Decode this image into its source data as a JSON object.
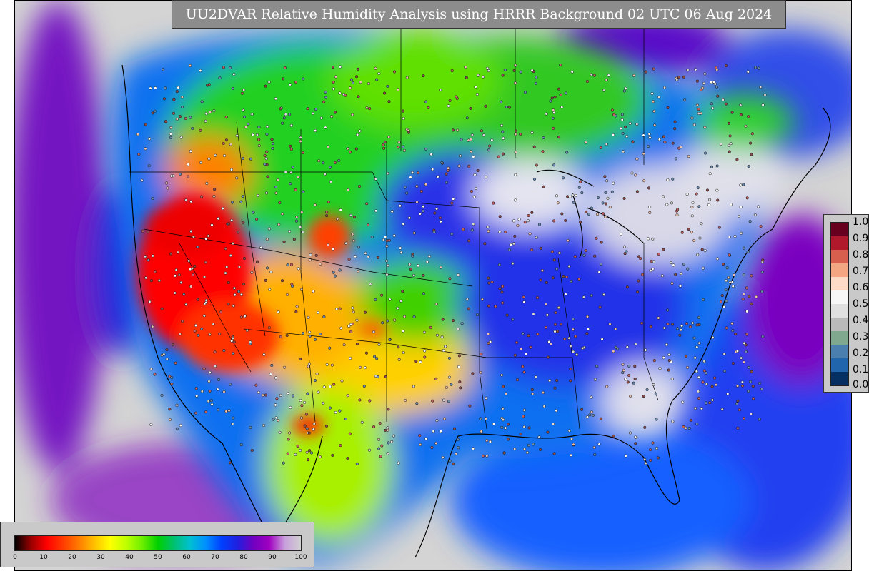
{
  "title": "UU2DVAR Relative Humidity Analysis using HRRR Background 02 UTC 06 Aug 2024",
  "humidity_legend": {
    "ticks": [
      "0",
      "10",
      "20",
      "30",
      "40",
      "50",
      "60",
      "70",
      "80",
      "90",
      "100"
    ],
    "colors": [
      "#000000",
      "#9a0000",
      "#ff0000",
      "#ff3a00",
      "#ff7a00",
      "#ffc000",
      "#ffff00",
      "#bfff00",
      "#6fef00",
      "#00d000",
      "#00c070",
      "#00c0d0",
      "#0090ff",
      "#0040ff",
      "#2020e0",
      "#7000c0",
      "#a000c0",
      "#c8a0dc",
      "#d0d0d0"
    ]
  },
  "error_legend": {
    "ticks": [
      "1.0",
      "0.9",
      "0.8",
      "0.7",
      "0.6",
      "0.5",
      "0.4",
      "0.3",
      "0.2",
      "0.1",
      "0.0"
    ],
    "colors": [
      "#67001f",
      "#b2182b",
      "#d6604d",
      "#f4a582",
      "#fddbc7",
      "#f7f7f7",
      "#e0e0e0",
      "#bababa",
      "#7fa88f",
      "#4a7fb0",
      "#2166ac",
      "#053061"
    ]
  }
}
